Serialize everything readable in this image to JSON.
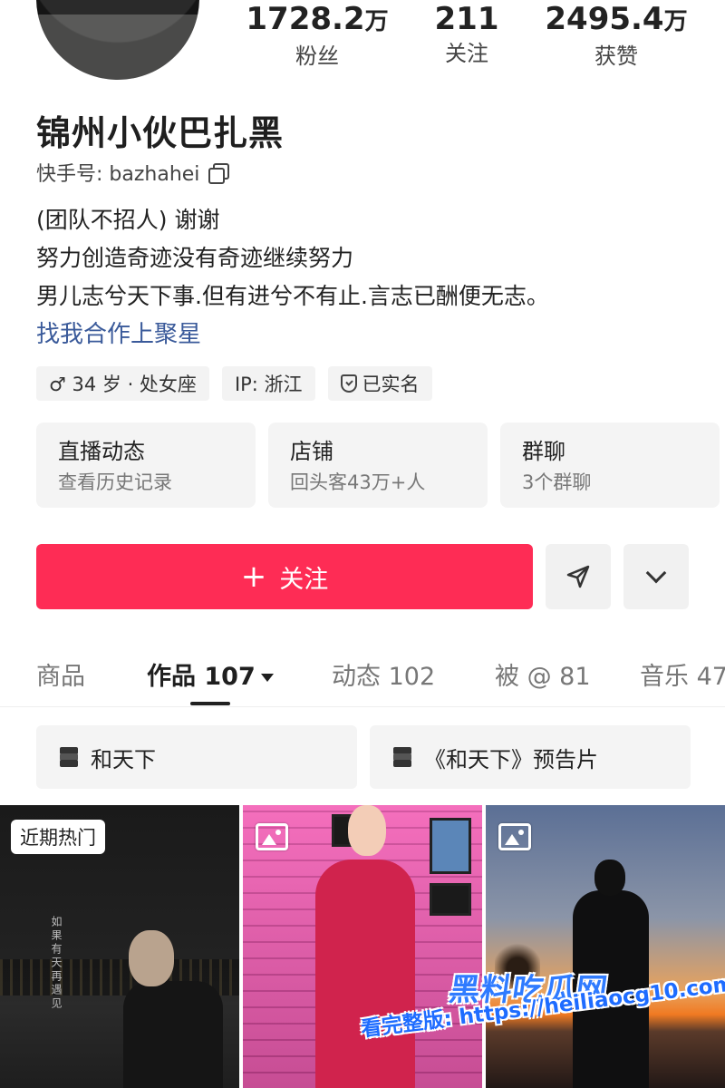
{
  "profile": {
    "name": "锦州小伙巴扎黑",
    "kuaishou_id": "快手号: bazhahei",
    "bio": [
      "(团队不招人) 谢谢",
      "努力创造奇迹没有奇迹继续努力",
      "男儿志兮天下事.但有进兮不有止.言志已酬便无志。"
    ],
    "bio_link": "找我合作上聚星"
  },
  "stats": {
    "fans": {
      "value": "1728.2",
      "unit": "万",
      "label": "粉丝"
    },
    "following": {
      "value": "211",
      "label": "关注"
    },
    "likes": {
      "value": "2495.4",
      "unit": "万",
      "label": "获赞"
    }
  },
  "tags": {
    "age": "♂ 34 岁 · 处女座",
    "ip": "IP: 浙江",
    "verified": "已实名"
  },
  "cards": [
    {
      "title": "直播动态",
      "sub": "查看历史记录"
    },
    {
      "title": "店铺",
      "sub": "回头客43万+人"
    },
    {
      "title": "群聊",
      "sub": "3个群聊"
    }
  ],
  "actions": {
    "follow": "关注",
    "follow_color": "#fe2c55"
  },
  "tabs": [
    {
      "label": "商品"
    },
    {
      "label": "作品 107"
    },
    {
      "label": "动态 102"
    },
    {
      "label": "被 @ 81"
    },
    {
      "label": "音乐 47"
    }
  ],
  "collections": [
    {
      "label": "和天下"
    },
    {
      "label": "《和天下》预告片"
    }
  ],
  "thumbs": {
    "hot_badge": "近期热门",
    "vertical_text": "如果有天再遇见"
  },
  "watermark": {
    "logo": "黑料吃瓜网",
    "url": "看完整版: https://heiliaocg10.com"
  }
}
